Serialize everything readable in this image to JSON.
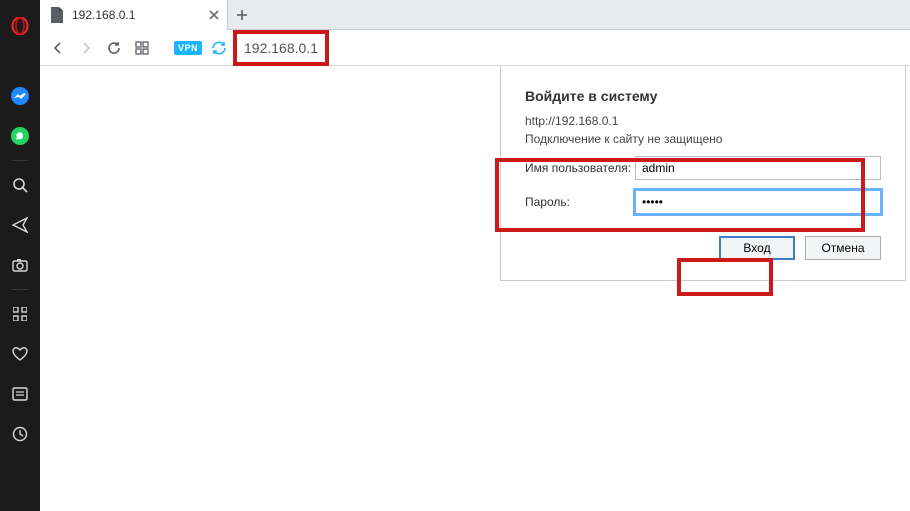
{
  "tab": {
    "title": "192.168.0.1"
  },
  "address": {
    "url": "192.168.0.1"
  },
  "vpn": {
    "label": "VPN"
  },
  "dialog": {
    "heading": "Войдите в систему",
    "origin": "http://192.168.0.1",
    "insecure": "Подключение к сайту не защищено",
    "username_label": "Имя пользователя:",
    "username_value": "admin",
    "password_label": "Пароль:",
    "password_value": "•••••",
    "login_label": "Вход",
    "cancel_label": "Отмена"
  }
}
